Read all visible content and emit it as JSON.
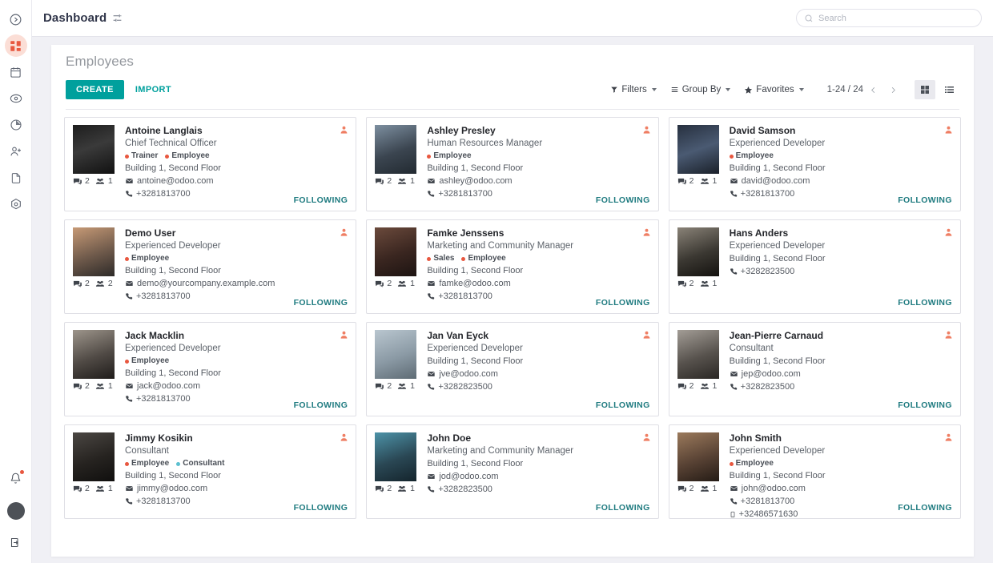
{
  "sidebar": {
    "items": [
      {
        "name": "expand-menu",
        "icon": "chevron-right-circle-icon",
        "active": false
      },
      {
        "name": "apps-dashboard",
        "icon": "apps-grid-icon",
        "active": true
      },
      {
        "name": "calendar",
        "icon": "calendar-icon",
        "active": false
      },
      {
        "name": "attendance",
        "icon": "eye-target-icon",
        "active": false
      },
      {
        "name": "reporting",
        "icon": "pie-chart-icon",
        "active": false
      },
      {
        "name": "recruitment",
        "icon": "person-add-icon",
        "active": false
      },
      {
        "name": "documents",
        "icon": "document-icon",
        "active": false
      },
      {
        "name": "settings",
        "icon": "gear-hex-icon",
        "active": false
      }
    ],
    "bottom": [
      {
        "name": "notifications",
        "icon": "bell-icon",
        "badge": true
      },
      {
        "name": "user-avatar",
        "icon": "avatar-icon"
      },
      {
        "name": "logout",
        "icon": "logout-icon"
      }
    ]
  },
  "topbar": {
    "title": "Dashboard",
    "settings_icon": "sliders-icon"
  },
  "search": {
    "placeholder": "Search",
    "value": "",
    "icon": "search-icon"
  },
  "control_panel": {
    "breadcrumb": "Employees",
    "create_label": "CREATE",
    "import_label": "IMPORT",
    "filters_label": "Filters",
    "group_by_label": "Group By",
    "favorites_label": "Favorites",
    "pager": "1-24 / 24",
    "prev_icon": "chevron-left-icon",
    "next_icon": "chevron-right-icon",
    "views": [
      {
        "name": "kanban",
        "icon": "kanban-grid-icon",
        "active": true
      },
      {
        "name": "list",
        "icon": "list-icon",
        "active": false
      }
    ]
  },
  "colors": {
    "accent_teal": "#00a09d",
    "brand_red": "#e8573f",
    "tag_red": "#e8573f",
    "tag_cyan": "#5bbfcf",
    "following_teal": "#1f7b80",
    "user_badge": "#ef7e63"
  },
  "labels": {
    "following": "FOLLOWING"
  },
  "employees": [
    {
      "name": "Antoine Langlais",
      "job": "Chief Technical Officer",
      "tags": [
        {
          "label": "Trainer",
          "color": "#e8573f"
        },
        {
          "label": "Employee",
          "color": "#e8573f"
        }
      ],
      "location": "Building 1, Second Floor",
      "email": "antoine@odoo.com",
      "phone": "+3281813700",
      "mobile": "",
      "messages": "2",
      "followers": "1",
      "following": "FOLLOWING",
      "photo_tone": "dark-bw"
    },
    {
      "name": "Ashley Presley",
      "job": "Human Resources Manager",
      "tags": [
        {
          "label": "Employee",
          "color": "#e8573f"
        }
      ],
      "location": "Building 1, Second Floor",
      "email": "ashley@odoo.com",
      "phone": "+3281813700",
      "mobile": "",
      "messages": "2",
      "followers": "1",
      "following": "FOLLOWING",
      "photo_tone": "blue-grey"
    },
    {
      "name": "David Samson",
      "job": "Experienced Developer",
      "tags": [
        {
          "label": "Employee",
          "color": "#e8573f"
        }
      ],
      "location": "Building 1, Second Floor",
      "email": "david@odoo.com",
      "phone": "+3281813700",
      "mobile": "",
      "messages": "2",
      "followers": "1",
      "following": "FOLLOWING",
      "photo_tone": "navy"
    },
    {
      "name": "Demo User",
      "job": "Experienced Developer",
      "tags": [
        {
          "label": "Employee",
          "color": "#e8573f"
        }
      ],
      "location": "Building 1, Second Floor",
      "email": "demo@yourcompany.example.com",
      "phone": "+3281813700",
      "mobile": "",
      "messages": "2",
      "followers": "2",
      "following": "FOLLOWING",
      "photo_tone": "warm"
    },
    {
      "name": "Famke Jenssens",
      "job": "Marketing and Community Manager",
      "tags": [
        {
          "label": "Sales",
          "color": "#e8573f"
        },
        {
          "label": "Employee",
          "color": "#e8573f"
        }
      ],
      "location": "Building 1, Second Floor",
      "email": "famke@odoo.com",
      "phone": "+3281813700",
      "mobile": "",
      "messages": "2",
      "followers": "1",
      "following": "FOLLOWING",
      "photo_tone": "brown"
    },
    {
      "name": "Hans Anders",
      "job": "Experienced Developer",
      "tags": [],
      "location": "Building 1, Second Floor",
      "email": "",
      "phone": "+3282823500",
      "mobile": "",
      "messages": "2",
      "followers": "1",
      "following": "FOLLOWING",
      "photo_tone": "dark-suit"
    },
    {
      "name": "Jack Macklin",
      "job": "Experienced Developer",
      "tags": [
        {
          "label": "Employee",
          "color": "#e8573f"
        }
      ],
      "location": "Building 1, Second Floor",
      "email": "jack@odoo.com",
      "phone": "+3281813700",
      "mobile": "",
      "messages": "2",
      "followers": "1",
      "following": "FOLLOWING",
      "photo_tone": "grey-beard"
    },
    {
      "name": "Jan Van Eyck",
      "job": "Experienced Developer",
      "tags": [],
      "location": "Building 1, Second Floor",
      "email": "jve@odoo.com",
      "phone": "+3282823500",
      "mobile": "",
      "messages": "2",
      "followers": "1",
      "following": "FOLLOWING",
      "photo_tone": "light-blue"
    },
    {
      "name": "Jean-Pierre Carnaud",
      "job": "Consultant",
      "tags": [],
      "location": "Building 1, Second Floor",
      "email": "jep@odoo.com",
      "phone": "+3282823500",
      "mobile": "",
      "messages": "2",
      "followers": "1",
      "following": "FOLLOWING",
      "photo_tone": "grey-suit"
    },
    {
      "name": "Jimmy Kosikin",
      "job": "Consultant",
      "tags": [
        {
          "label": "Employee",
          "color": "#e8573f"
        },
        {
          "label": "Consultant",
          "color": "#5bbfcf"
        }
      ],
      "location": "Building 1, Second Floor",
      "email": "jimmy@odoo.com",
      "phone": "+3281813700",
      "mobile": "",
      "messages": "2",
      "followers": "1",
      "following": "FOLLOWING",
      "photo_tone": "dark-hair"
    },
    {
      "name": "John Doe",
      "job": "Marketing and Community Manager",
      "tags": [],
      "location": "Building 1, Second Floor",
      "email": "jod@odoo.com",
      "phone": "+3282823500",
      "mobile": "",
      "messages": "2",
      "followers": "1",
      "following": "FOLLOWING",
      "photo_tone": "teal-bg"
    },
    {
      "name": "John Smith",
      "job": "Experienced Developer",
      "tags": [
        {
          "label": "Employee",
          "color": "#e8573f"
        }
      ],
      "location": "Building 1, Second Floor",
      "email": "john@odoo.com",
      "phone": "+3281813700",
      "mobile": "+32486571630",
      "messages": "2",
      "followers": "1",
      "following": "FOLLOWING",
      "photo_tone": "tan"
    }
  ]
}
